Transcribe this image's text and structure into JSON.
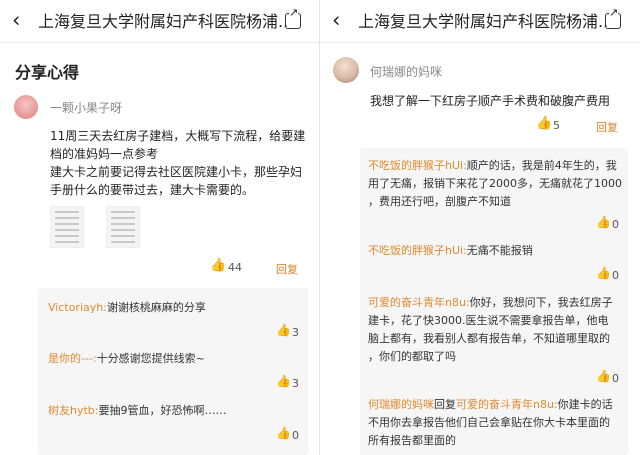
{
  "left": {
    "nav": {
      "back_icon": "‹",
      "title": "上海复旦大学附属妇产科医院杨浦...",
      "share_icon": "share-icon"
    },
    "section_title": "分享心得",
    "post": {
      "username": "一颗小果子呀",
      "text_lines": [
        "11周三天去红房子建档，大概写下流程，给要建",
        "档的准妈妈一点参考",
        "建大卡之前要记得去社区医院建小卡，那些孕妇",
        "手册什么的要带过去，建大卡需要的。"
      ],
      "likes": "44",
      "reply_label": "回复"
    },
    "comments": [
      {
        "name": "Victoriayh:",
        "text": "谢谢核桃麻麻的分享",
        "likes": "3"
      },
      {
        "name": "是你的---:",
        "text": "十分感谢您提供线索~",
        "likes": "3"
      },
      {
        "name": "树友hytb:",
        "text": "要抽9管血，好恐怖啊……",
        "likes": "0"
      }
    ]
  },
  "right": {
    "nav": {
      "back_icon": "‹",
      "title": "上海复旦大学附属妇产科医院杨浦...",
      "share_icon": "share-icon"
    },
    "post": {
      "username": "何瑞娜的妈咪",
      "text": "我想了解一下红房子顺产手术费和破腹产费用",
      "likes": "5",
      "reply_label": "回复"
    },
    "comments": [
      {
        "name": "不吃饭的胖猴子hUi:",
        "lines": [
          "顺产的话，我是前4年生的，我",
          "用了无痛，报销下来花了2000多，无痛就花了1000",
          "，费用还行吧，剖腹产不知道"
        ],
        "likes": "0"
      },
      {
        "name": "不吃饭的胖猴子hUi:",
        "lines": [
          "无痛不能报销"
        ],
        "likes": "0"
      },
      {
        "name": "可爱的奋斗青年n8u:",
        "lines": [
          "你好，我想问下，我去红房子",
          "建卡，花了快3000.医生说不需要拿报告单，他电",
          "脑上都有，我看别人都有报告单，不知道哪里取的",
          "，你们的都取了吗"
        ],
        "likes": "0"
      },
      {
        "name": "何瑞娜的妈咪",
        "mid": "回复",
        "name2": "可爱的奋斗青年n8u:",
        "lines": [
          "你建卡的话",
          "不用你去拿报告他们自己会拿贴在你大卡本里面的",
          "所有报告都里面的"
        ]
      }
    ]
  },
  "colors": {
    "accent_orange": "#e08a2e",
    "comment_bg": "#f6f6f6"
  }
}
